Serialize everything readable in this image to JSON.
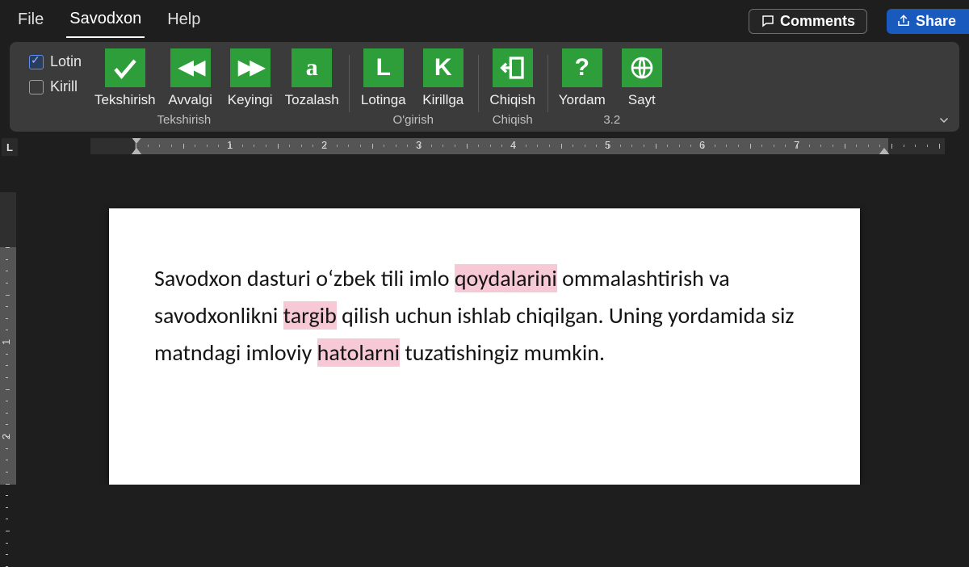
{
  "menubar": {
    "items": [
      {
        "label": "File",
        "active": false
      },
      {
        "label": "Savodxon",
        "active": true
      },
      {
        "label": "Help",
        "active": false
      }
    ],
    "comments": "Comments",
    "share": "Share"
  },
  "ribbon": {
    "checks": [
      {
        "label": "Lotin",
        "checked": true
      },
      {
        "label": "Kirill",
        "checked": false
      }
    ],
    "groups": [
      {
        "name": "tekshirish",
        "label": "Tekshirish",
        "buttons": [
          {
            "id": "tekshirish",
            "label": "Tekshirish",
            "glyph": "✓",
            "icon": "check-icon"
          },
          {
            "id": "avvalgi",
            "label": "Avvalgi",
            "glyph": "◀◀",
            "icon": "prev-icon"
          },
          {
            "id": "keyingi",
            "label": "Keyingi",
            "glyph": "▶▶",
            "icon": "next-icon"
          },
          {
            "id": "tozalash",
            "label": "Tozalash",
            "glyph": "a",
            "icon": "clear-icon"
          }
        ]
      },
      {
        "name": "ogirish",
        "label": "O'girish",
        "buttons": [
          {
            "id": "lotinga",
            "label": "Lotinga",
            "glyph": "L",
            "icon": "letter-l-icon"
          },
          {
            "id": "kirillga",
            "label": "Kirillga",
            "glyph": "K",
            "icon": "letter-k-icon"
          }
        ]
      },
      {
        "name": "chiqish",
        "label": "Chiqish",
        "buttons": [
          {
            "id": "chiqish",
            "label": "Chiqish",
            "glyph": "⇤",
            "icon": "exit-icon"
          }
        ]
      },
      {
        "name": "version",
        "label": "3.2",
        "buttons": [
          {
            "id": "yordam",
            "label": "Yordam",
            "glyph": "?",
            "icon": "help-icon"
          },
          {
            "id": "sayt",
            "label": "Sayt",
            "glyph": "⊕",
            "icon": "globe-icon"
          }
        ]
      }
    ]
  },
  "ruler_numbers": [
    "1",
    "2",
    "3",
    "4",
    "5",
    "6",
    "7"
  ],
  "document": {
    "p1_part1": "Savodxon dasturi oʻzbek tili imlo ",
    "p1_err1": "qoydalarini",
    "p1_part2": " ommalashtirish va savodxonlikni ",
    "p1_err2": "targib",
    "p1_part3": " qilish uchun ishlab chiqilgan. Uning yordamida siz matndagi imloviy ",
    "p1_err3": "hatolarni",
    "p1_part4": " tuzatishingiz mumkin."
  }
}
